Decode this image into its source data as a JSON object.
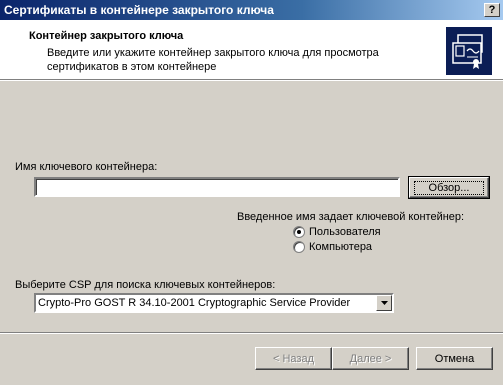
{
  "window": {
    "title": "Сертификаты в контейнере закрытого ключа",
    "help_glyph": "?"
  },
  "header": {
    "title": "Контейнер закрытого ключа",
    "description": "Введите или укажите контейнер закрытого ключа для просмотра сертификатов в этом контейнере",
    "icon": "certificate-icon"
  },
  "container": {
    "label": "Имя ключевого контейнера:",
    "value": "",
    "browse_label": "Обзор..."
  },
  "scope": {
    "label": "Введенное имя задает ключевой контейнер:",
    "options": [
      {
        "label": "Пользователя",
        "checked": true
      },
      {
        "label": "Компьютера",
        "checked": false
      }
    ]
  },
  "csp": {
    "label": "Выберите CSP для поиска ключевых контейнеров:",
    "selected": "Crypto-Pro GOST R 34.10-2001 Cryptographic Service Provider"
  },
  "footer": {
    "back_label": "< Назад",
    "next_label": "Далее >",
    "cancel_label": "Отмена"
  }
}
